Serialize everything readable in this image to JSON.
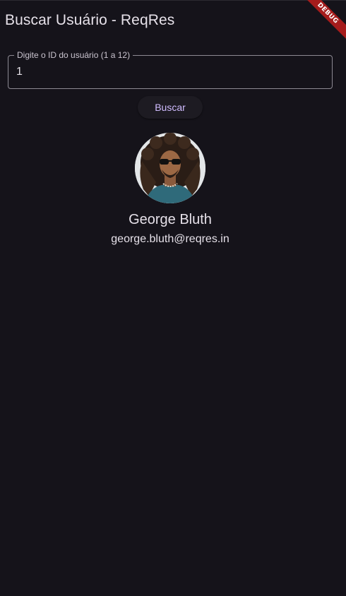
{
  "app_bar": {
    "title": "Buscar Usuário - ReqRes",
    "debug_label": "DEBUG"
  },
  "search": {
    "label": "Digite o ID do usuário (1 a 12)",
    "value": "1",
    "button_label": "Buscar"
  },
  "user": {
    "name": "George Bluth",
    "email": "george.bluth@reqres.in"
  },
  "colors": {
    "background": "#15131a",
    "accent": "#d0bcff",
    "debug_ribbon": "#a51c1c"
  }
}
